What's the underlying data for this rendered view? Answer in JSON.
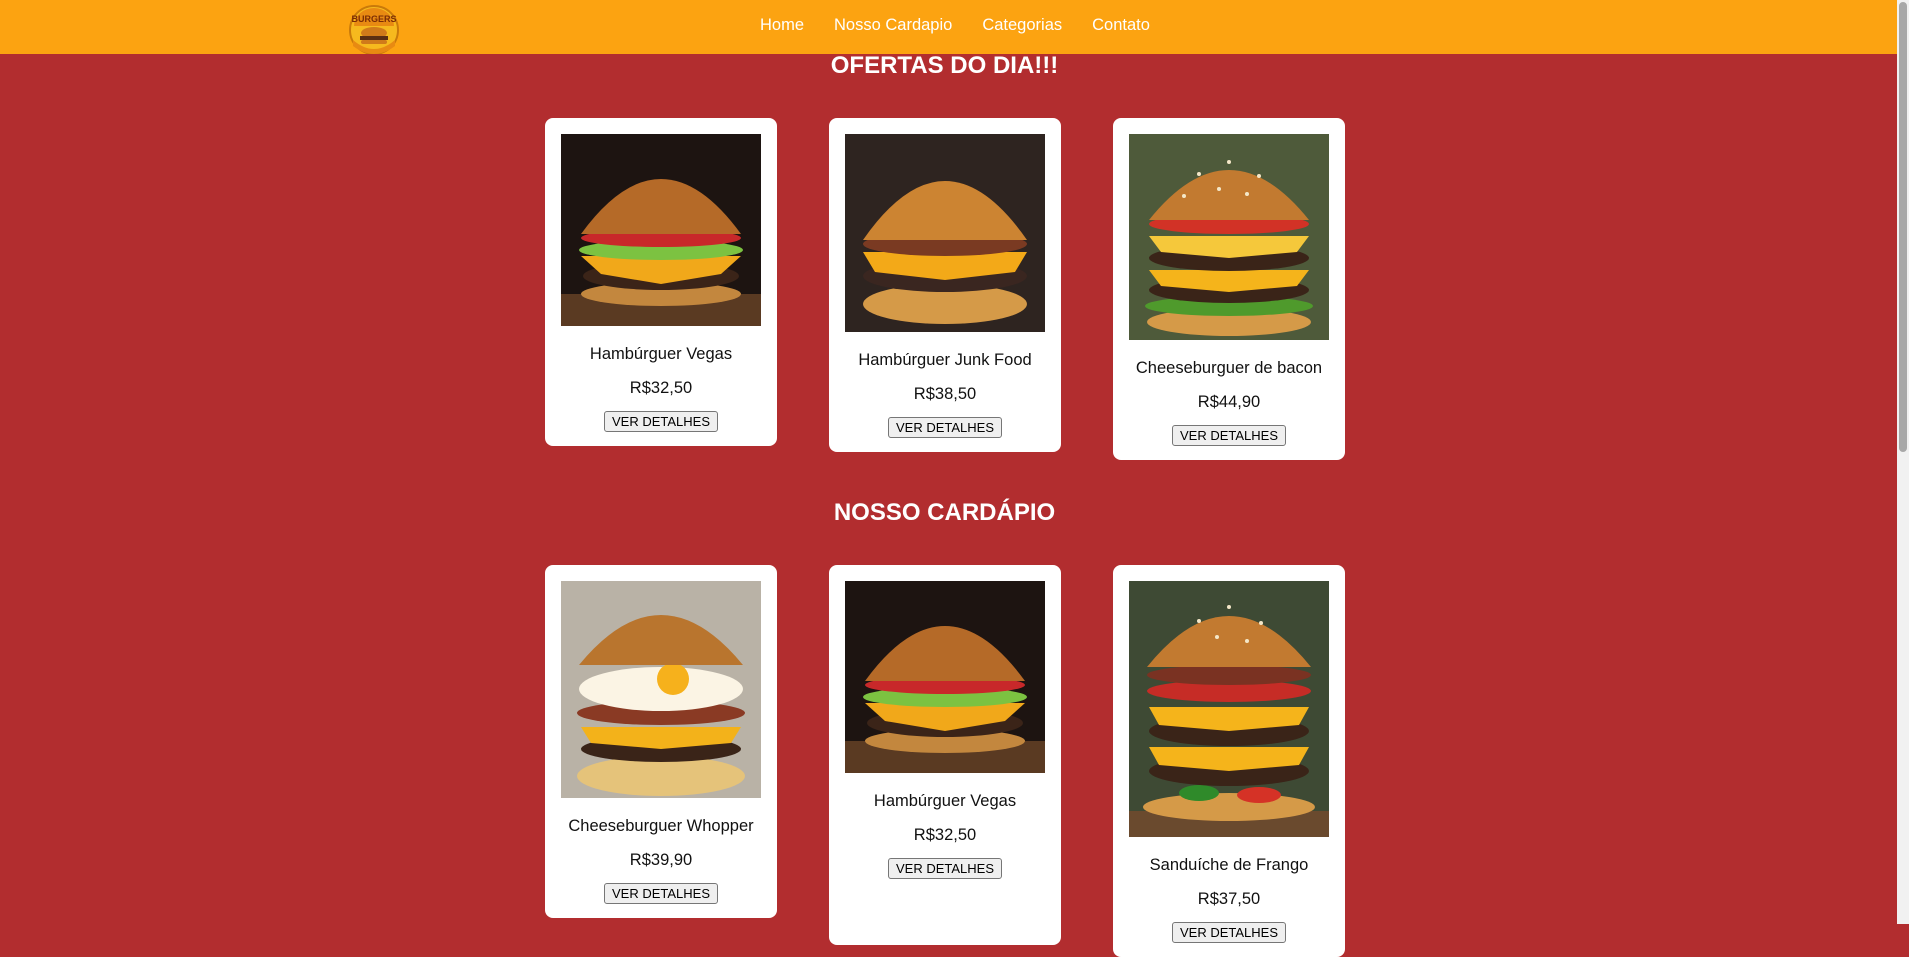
{
  "nav": {
    "logo_text": "BURGERS",
    "links": [
      "Home",
      "Nosso Cardapio",
      "Categorias",
      "Contato"
    ]
  },
  "offers": {
    "title": "OFERTAS DO DIA!!!",
    "items": [
      {
        "name": "Hambúrguer Vegas",
        "price": "R$32,50",
        "button": "VER DETALHES"
      },
      {
        "name": "Hambúrguer Junk Food",
        "price": "R$38,50",
        "button": "VER DETALHES"
      },
      {
        "name": "Cheeseburguer de bacon",
        "price": "R$44,90",
        "button": "VER DETALHES"
      }
    ]
  },
  "menu": {
    "title": "NOSSO CARDÁPIO",
    "items": [
      {
        "name": "Cheeseburguer Whopper",
        "price": "R$39,90",
        "button": "VER DETALHES"
      },
      {
        "name": "Hambúrguer Vegas",
        "price": "R$32,50",
        "button": "VER DETALHES"
      },
      {
        "name": "Sanduíche de Frango",
        "price": "R$37,50",
        "button": "VER DETALHES"
      }
    ]
  },
  "colors": {
    "page_background": "#b22d2f",
    "header_background": "#fca311",
    "card_background": "#ffffff"
  }
}
